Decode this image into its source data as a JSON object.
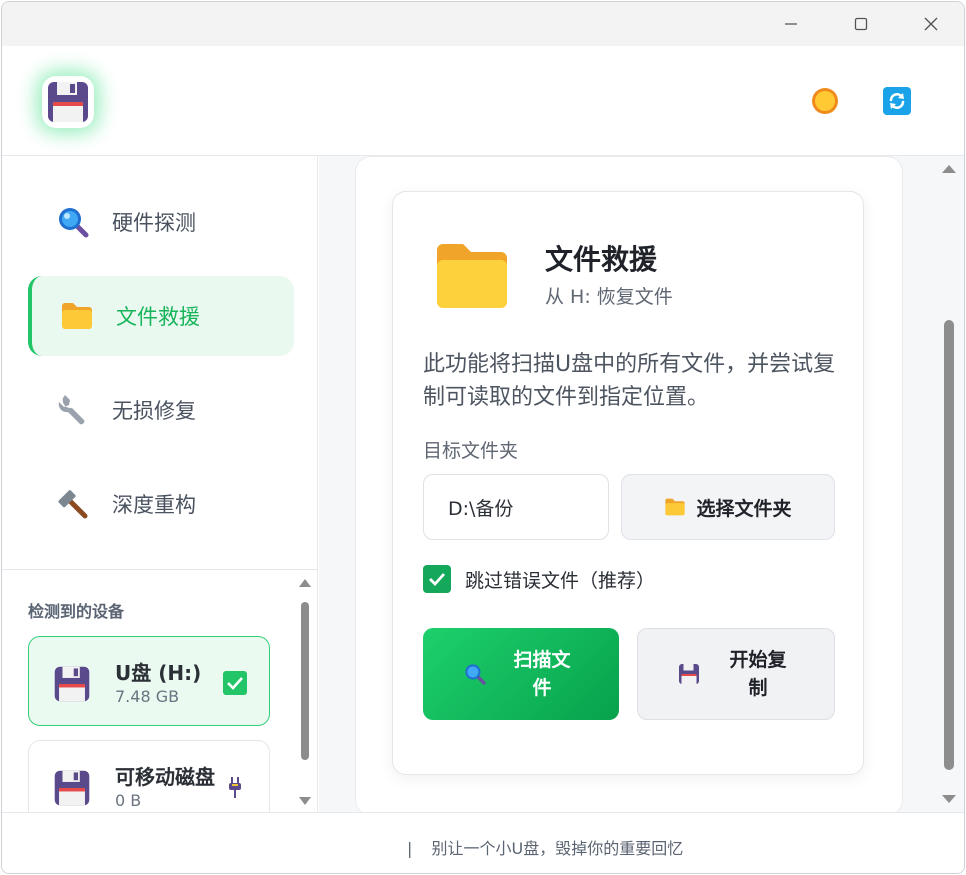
{
  "window": {
    "controls": {
      "minimize": "minimize",
      "maximize": "maximize",
      "close": "close"
    }
  },
  "header": {
    "logo_icon": "floppy-disk-icon",
    "theme_icon": "sun-icon",
    "refresh_icon": "refresh-icon"
  },
  "sidebar": {
    "items": [
      {
        "label": "硬件探测",
        "icon": "magnifier-icon"
      },
      {
        "label": "文件救援",
        "icon": "folder-icon",
        "active": true
      },
      {
        "label": "无损修复",
        "icon": "wrench-icon"
      },
      {
        "label": "深度重构",
        "icon": "hammer-icon"
      }
    ],
    "devices_title": "检测到的设备",
    "devices": [
      {
        "name": "U盘 (H:)",
        "size": "7.48 GB",
        "selected": true,
        "status_icon": "check-icon"
      },
      {
        "name": "可移动磁盘",
        "size": "0 B",
        "selected": false,
        "status_icon": "plug-icon"
      }
    ]
  },
  "main": {
    "card": {
      "title": "文件救援",
      "subtitle": "从 H: 恢复文件",
      "description": "此功能将扫描U盘中的所有文件，并尝试复制可读取的文件到指定位置。",
      "target_label": "目标文件夹",
      "target_value": "D:\\备份",
      "choose_button": "选择文件夹",
      "skip_label": "跳过错误文件（推荐）",
      "skip_checked": true,
      "scan_button": "扫描文件",
      "copy_button": "开始复制"
    }
  },
  "footer": {
    "separator": "|",
    "slogan": "别让一个小U盘，毁掉你的重要回忆"
  },
  "colors": {
    "accent": "#22c567",
    "accent_dark": "#07a24c",
    "active_bg": "#e9f9ef",
    "folder": "#fbc02d"
  }
}
